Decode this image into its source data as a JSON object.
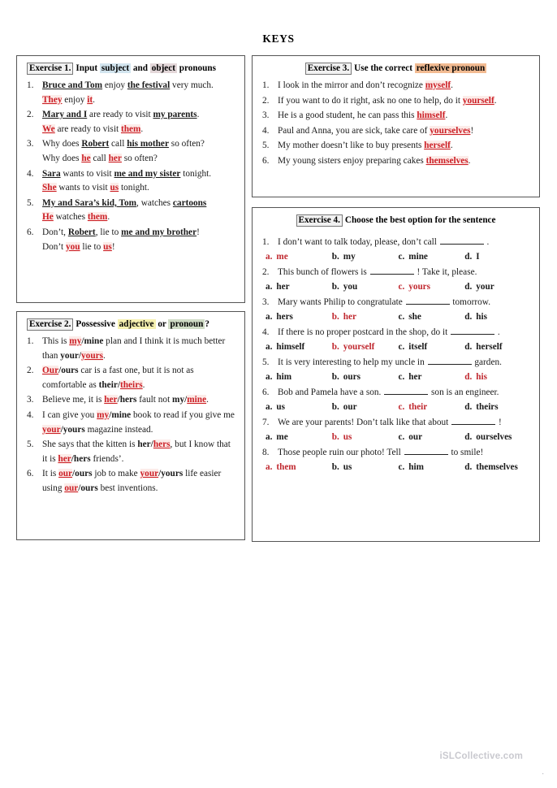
{
  "title": "KEYS",
  "watermark": {
    "text": "iSLCollective.com",
    "dot": "."
  },
  "exercise1": {
    "tag": "Exercise 1.",
    "head_a": "Input",
    "head_hl1": "subject",
    "head_b": "and",
    "head_hl2": "object",
    "head_c": "pronouns",
    "items": [
      {
        "n": "1.",
        "q": [
          {
            "t": "Bruce and Tom",
            "s": "bu"
          },
          {
            "t": " enjoy ",
            "s": ""
          },
          {
            "t": "the festival",
            "s": "bu"
          },
          {
            "t": " very much.",
            "s": ""
          }
        ],
        "a": [
          {
            "t": "They",
            "s": "red"
          },
          {
            "t": " enjoy ",
            "s": ""
          },
          {
            "t": "it",
            "s": "red"
          },
          {
            "t": ".",
            "s": ""
          }
        ]
      },
      {
        "n": "2.",
        "q": [
          {
            "t": "Mary and I",
            "s": "bu"
          },
          {
            "t": " are ready to visit ",
            "s": ""
          },
          {
            "t": "my parents",
            "s": "bu"
          },
          {
            "t": ".",
            "s": ""
          }
        ],
        "a": [
          {
            "t": "We",
            "s": "red"
          },
          {
            "t": " are ready to visit ",
            "s": ""
          },
          {
            "t": "them",
            "s": "red"
          },
          {
            "t": ".",
            "s": ""
          }
        ]
      },
      {
        "n": "3.",
        "q": [
          {
            "t": "Why does ",
            "s": ""
          },
          {
            "t": "Robert",
            "s": "bu"
          },
          {
            "t": " call ",
            "s": ""
          },
          {
            "t": "his mother",
            "s": "bu"
          },
          {
            "t": " so often?",
            "s": ""
          }
        ],
        "a": [
          {
            "t": "Why does ",
            "s": ""
          },
          {
            "t": "he",
            "s": "red"
          },
          {
            "t": " call ",
            "s": ""
          },
          {
            "t": "her",
            "s": "red"
          },
          {
            "t": " so often?",
            "s": ""
          }
        ]
      },
      {
        "n": "4.",
        "q": [
          {
            "t": "Sara",
            "s": "bu"
          },
          {
            "t": " wants to visit ",
            "s": ""
          },
          {
            "t": "me and my sister",
            "s": "bu"
          },
          {
            "t": " tonight.",
            "s": ""
          }
        ],
        "a": [
          {
            "t": "She",
            "s": "red"
          },
          {
            "t": " wants to visit ",
            "s": ""
          },
          {
            "t": "us",
            "s": "red"
          },
          {
            "t": " tonight.",
            "s": ""
          }
        ]
      },
      {
        "n": "5.",
        "q": [
          {
            "t": "My and Sara’s kid, Tom",
            "s": "bu"
          },
          {
            "t": ", watches ",
            "s": ""
          },
          {
            "t": "cartoons",
            "s": "bu"
          }
        ],
        "a": [
          {
            "t": "He",
            "s": "red"
          },
          {
            "t": " watches ",
            "s": ""
          },
          {
            "t": "them",
            "s": "red"
          },
          {
            "t": ".",
            "s": ""
          }
        ]
      },
      {
        "n": "6.",
        "q": [
          {
            "t": "Don’t, ",
            "s": ""
          },
          {
            "t": "Robert",
            "s": "bu"
          },
          {
            "t": ", lie to ",
            "s": ""
          },
          {
            "t": "me and my brother",
            "s": "bu"
          },
          {
            "t": "!",
            "s": ""
          }
        ],
        "a": [
          {
            "t": "Don’t ",
            "s": ""
          },
          {
            "t": "you",
            "s": "red"
          },
          {
            "t": " lie to ",
            "s": ""
          },
          {
            "t": "us",
            "s": "red"
          },
          {
            "t": "!",
            "s": ""
          }
        ]
      }
    ]
  },
  "exercise2": {
    "tag": "Exercise 2.",
    "head_a": "Possessive",
    "head_hl1": "adjective",
    "head_b": "or",
    "head_hl2": "pronoun",
    "head_c": "?",
    "items": [
      {
        "n": "1.",
        "q": [
          {
            "t": "This is ",
            "s": ""
          },
          {
            "t": "my",
            "s": "red"
          },
          {
            "t": "/mine",
            "s": "b"
          },
          {
            "t": " plan and I think it is much better than ",
            "s": ""
          },
          {
            "t": "your/",
            "s": "b"
          },
          {
            "t": "yours",
            "s": "red"
          },
          {
            "t": ".",
            "s": ""
          }
        ]
      },
      {
        "n": "2.",
        "q": [
          {
            "t": "Our",
            "s": "red"
          },
          {
            "t": "/ours",
            "s": "b"
          },
          {
            "t": " car is a fast one, but it is not as comfortable as ",
            "s": ""
          },
          {
            "t": "their/",
            "s": "b"
          },
          {
            "t": "theirs",
            "s": "red"
          },
          {
            "t": ".",
            "s": ""
          }
        ]
      },
      {
        "n": "3.",
        "q": [
          {
            "t": "Believe me, it is ",
            "s": ""
          },
          {
            "t": "her",
            "s": "red"
          },
          {
            "t": "/hers",
            "s": "b"
          },
          {
            "t": " fault not ",
            "s": ""
          },
          {
            "t": "my/",
            "s": "b"
          },
          {
            "t": "mine",
            "s": "red"
          },
          {
            "t": ".",
            "s": ""
          }
        ]
      },
      {
        "n": "4.",
        "q": [
          {
            "t": "I can give you ",
            "s": ""
          },
          {
            "t": "my",
            "s": "red"
          },
          {
            "t": "/mine",
            "s": "b"
          },
          {
            "t": " book to read if you give me ",
            "s": ""
          },
          {
            "t": "your",
            "s": "red"
          },
          {
            "t": "/yours",
            "s": "b"
          },
          {
            "t": " magazine instead.",
            "s": ""
          }
        ]
      },
      {
        "n": "5.",
        "q": [
          {
            "t": "She says that the kitten is ",
            "s": ""
          },
          {
            "t": "her/",
            "s": "b"
          },
          {
            "t": "hers",
            "s": "red"
          },
          {
            "t": ", but I know that it is ",
            "s": ""
          },
          {
            "t": "her",
            "s": "red"
          },
          {
            "t": "/hers",
            "s": "b"
          },
          {
            "t": " friends’.",
            "s": ""
          }
        ]
      },
      {
        "n": "6.",
        "q": [
          {
            "t": "It is ",
            "s": ""
          },
          {
            "t": "our",
            "s": "red"
          },
          {
            "t": "/ours",
            "s": "b"
          },
          {
            "t": " job to make ",
            "s": ""
          },
          {
            "t": "your",
            "s": "red"
          },
          {
            "t": "/yours",
            "s": "b"
          },
          {
            "t": " life easier using ",
            "s": ""
          },
          {
            "t": "our",
            "s": "red"
          },
          {
            "t": "/ours",
            "s": "b"
          },
          {
            "t": " best inventions.",
            "s": ""
          }
        ]
      }
    ]
  },
  "exercise3": {
    "tag": "Exercise 3.",
    "head_a": "Use the correct",
    "head_hl1": "reflexive pronoun",
    "items": [
      {
        "n": "1.",
        "q": [
          {
            "t": "I look in the mirror and don’t recognize ",
            "s": ""
          },
          {
            "t": "myself",
            "s": "red"
          },
          {
            "t": ".",
            "s": ""
          }
        ]
      },
      {
        "n": "2.",
        "q": [
          {
            "t": "If you want to do it right, ask no one to help, do it ",
            "s": ""
          },
          {
            "t": "yourself",
            "s": "red"
          },
          {
            "t": ".",
            "s": ""
          }
        ]
      },
      {
        "n": "3.",
        "q": [
          {
            "t": "He is a good student, he can pass this ",
            "s": ""
          },
          {
            "t": "himself",
            "s": "red"
          },
          {
            "t": ".",
            "s": ""
          }
        ]
      },
      {
        "n": "4.",
        "q": [
          {
            "t": "Paul and Anna, you are sick, take care of ",
            "s": ""
          },
          {
            "t": "yourselves",
            "s": "red"
          },
          {
            "t": "!",
            "s": ""
          }
        ]
      },
      {
        "n": "5.",
        "q": [
          {
            "t": "My mother doesn’t like to buy presents ",
            "s": ""
          },
          {
            "t": "herself",
            "s": "red"
          },
          {
            "t": ".",
            "s": ""
          }
        ]
      },
      {
        "n": "6.",
        "q": [
          {
            "t": "My young sisters enjoy preparing cakes ",
            "s": ""
          },
          {
            "t": "themselves",
            "s": "red"
          },
          {
            "t": ".",
            "s": ""
          }
        ]
      }
    ]
  },
  "exercise4": {
    "tag": "Exercise 4.",
    "head_a": "Choose the best option for the sentence",
    "questions": [
      {
        "n": "1.",
        "pre": "I don’t want to talk today, please, don’t call",
        "post": ".",
        "options": [
          {
            "k": "a.",
            "v": "me",
            "correct": true
          },
          {
            "k": "b.",
            "v": "my",
            "correct": false
          },
          {
            "k": "c.",
            "v": "mine",
            "correct": false
          },
          {
            "k": "d.",
            "v": "I",
            "correct": false
          }
        ]
      },
      {
        "n": "2.",
        "pre": "This bunch of flowers is",
        "post": "! Take it, please.",
        "options": [
          {
            "k": "a.",
            "v": "her",
            "correct": false
          },
          {
            "k": "b.",
            "v": "you",
            "correct": false
          },
          {
            "k": "c.",
            "v": "yours",
            "correct": true
          },
          {
            "k": "d.",
            "v": "your",
            "correct": false
          }
        ]
      },
      {
        "n": "3.",
        "pre": "Mary wants Philip to congratulate",
        "post": "tomorrow.",
        "options": [
          {
            "k": "a.",
            "v": "hers",
            "correct": false
          },
          {
            "k": "b.",
            "v": "her",
            "correct": true
          },
          {
            "k": "c.",
            "v": "she",
            "correct": false
          },
          {
            "k": "d.",
            "v": "his",
            "correct": false
          }
        ]
      },
      {
        "n": "4.",
        "pre": "If there is no proper postcard in the shop, do it",
        "post": ".",
        "options": [
          {
            "k": "a.",
            "v": "himself",
            "correct": false
          },
          {
            "k": "b.",
            "v": "yourself",
            "correct": true
          },
          {
            "k": "c.",
            "v": "itself",
            "correct": false
          },
          {
            "k": "d.",
            "v": "herself",
            "correct": false
          }
        ]
      },
      {
        "n": "5.",
        "pre": "It is very interesting to help my uncle in",
        "post": "garden.",
        "options": [
          {
            "k": "a.",
            "v": "him",
            "correct": false
          },
          {
            "k": "b.",
            "v": "ours",
            "correct": false
          },
          {
            "k": "c.",
            "v": "her",
            "correct": false
          },
          {
            "k": "d.",
            "v": "his",
            "correct": true
          }
        ]
      },
      {
        "n": "6.",
        "pre": "Bob and Pamela have a son.",
        "post": "son is an engineer.",
        "options": [
          {
            "k": "a.",
            "v": "us",
            "correct": false
          },
          {
            "k": "b.",
            "v": "our",
            "correct": false
          },
          {
            "k": "c.",
            "v": "their",
            "correct": true
          },
          {
            "k": "d.",
            "v": "theirs",
            "correct": false
          }
        ]
      },
      {
        "n": "7.",
        "pre": "We are your parents! Don’t talk like that about",
        "post": "!",
        "options": [
          {
            "k": "a.",
            "v": "me",
            "correct": false
          },
          {
            "k": "b.",
            "v": "us",
            "correct": true
          },
          {
            "k": "c.",
            "v": "our",
            "correct": false
          },
          {
            "k": "d.",
            "v": "ourselves",
            "correct": false
          }
        ]
      },
      {
        "n": "8.",
        "pre": "Those people ruin our photo! Tell",
        "post": "to smile!",
        "options": [
          {
            "k": "a.",
            "v": "them",
            "correct": true
          },
          {
            "k": "b.",
            "v": "us",
            "correct": false
          },
          {
            "k": "c.",
            "v": "him",
            "correct": false
          },
          {
            "k": "d.",
            "v": "themselves",
            "correct": false
          }
        ]
      }
    ]
  }
}
